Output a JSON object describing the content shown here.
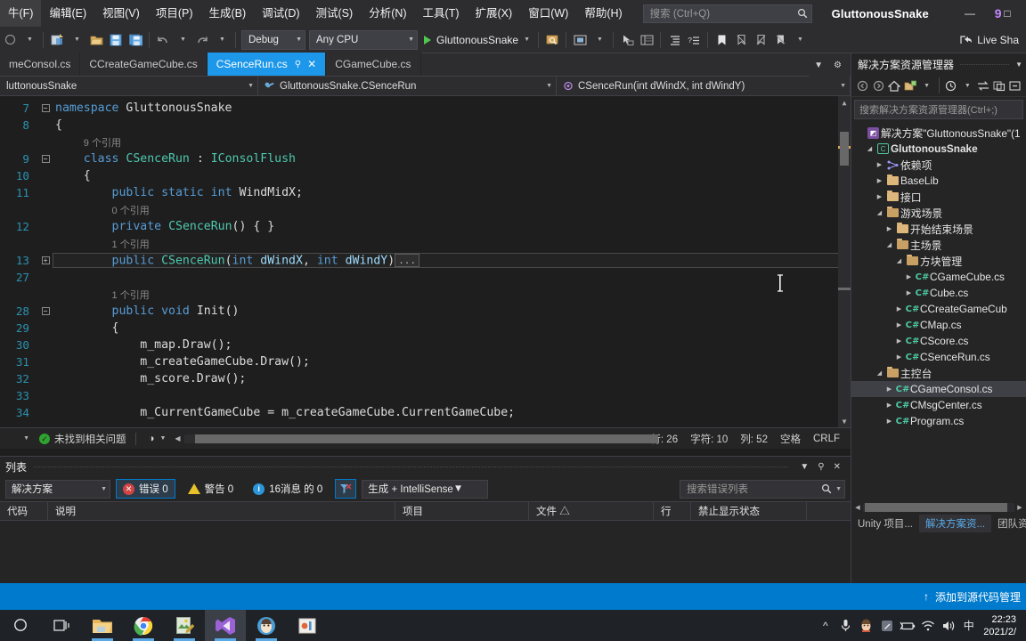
{
  "titlebar": {
    "menu": [
      "牛(F)",
      "编辑(E)",
      "视图(V)",
      "项目(P)",
      "生成(B)",
      "调试(D)",
      "测试(S)",
      "分析(N)",
      "工具(T)",
      "扩展(X)",
      "窗口(W)",
      "帮助(H)"
    ],
    "search_placeholder": "搜索 (Ctrl+Q)",
    "solution_name": "GluttonousSnake",
    "notification_count": "9",
    "minimize": "—",
    "restore": "□"
  },
  "toolbar": {
    "config": "Debug",
    "platform": "Any CPU",
    "run_target": "GluttonousSnake",
    "live_share": "Live Sha"
  },
  "tabs": [
    {
      "label": "meConsol.cs",
      "active": false
    },
    {
      "label": "CCreateGameCube.cs",
      "active": false
    },
    {
      "label": "CSenceRun.cs",
      "active": true
    },
    {
      "label": "CGameCube.cs",
      "active": false
    }
  ],
  "navbar": {
    "project": "luttonousSnake",
    "type": "GluttonousSnake.CSenceRun",
    "member": "CSenceRun(int dWindX, int dWindY)"
  },
  "code": {
    "lines": [
      {
        "num": "7",
        "fold": "minus",
        "segments": [
          {
            "t": "namespace ",
            "c": "kw"
          },
          {
            "t": "GluttonousSnake",
            "c": "pln"
          }
        ],
        "indent": ""
      },
      {
        "num": "8",
        "fold": "",
        "segments": [
          {
            "t": "{",
            "c": "pln"
          }
        ],
        "indent": ""
      },
      {
        "num": "",
        "fold": "",
        "ref": "9 个引用",
        "indent": "    "
      },
      {
        "num": "9",
        "fold": "minus",
        "segments": [
          {
            "t": "class ",
            "c": "kw"
          },
          {
            "t": "CSenceRun",
            "c": "typ"
          },
          {
            "t": " : ",
            "c": "pln"
          },
          {
            "t": "IConsolFlush",
            "c": "typ"
          }
        ],
        "indent": "    "
      },
      {
        "num": "10",
        "fold": "",
        "segments": [
          {
            "t": "{",
            "c": "pln"
          }
        ],
        "indent": "    "
      },
      {
        "num": "11",
        "fold": "",
        "segments": [
          {
            "t": "public static int ",
            "c": "kw"
          },
          {
            "t": "WindMidX;",
            "c": "pln"
          }
        ],
        "indent": "        "
      },
      {
        "num": "",
        "fold": "",
        "ref": "0 个引用",
        "indent": "        "
      },
      {
        "num": "12",
        "fold": "",
        "segments": [
          {
            "t": "private ",
            "c": "kw"
          },
          {
            "t": "CSenceRun",
            "c": "typ"
          },
          {
            "t": "() { }",
            "c": "pln"
          }
        ],
        "indent": "        "
      },
      {
        "num": "",
        "fold": "",
        "ref": "1 个引用",
        "indent": "        "
      },
      {
        "num": "13",
        "fold": "plus",
        "current": true,
        "segments": [
          {
            "t": "public ",
            "c": "kw"
          },
          {
            "t": "CSenceRun",
            "c": "typ"
          },
          {
            "t": "(",
            "c": "pln"
          },
          {
            "t": "int ",
            "c": "kw"
          },
          {
            "t": "dWindX",
            "c": "par"
          },
          {
            "t": ", ",
            "c": "pln"
          },
          {
            "t": "int ",
            "c": "kw"
          },
          {
            "t": "dWindY",
            "c": "par"
          },
          {
            "t": ")",
            "c": "pln"
          }
        ],
        "ellipsis": "...",
        "indent": "        "
      },
      {
        "num": "27",
        "fold": "",
        "segments": [],
        "indent": ""
      },
      {
        "num": "",
        "fold": "",
        "ref": "1 个引用",
        "indent": "        "
      },
      {
        "num": "28",
        "fold": "minus",
        "segments": [
          {
            "t": "public void ",
            "c": "kw"
          },
          {
            "t": "Init",
            "c": "pln"
          },
          {
            "t": "()",
            "c": "pln"
          }
        ],
        "indent": "        "
      },
      {
        "num": "29",
        "fold": "",
        "segments": [
          {
            "t": "{",
            "c": "pln"
          }
        ],
        "indent": "        "
      },
      {
        "num": "30",
        "fold": "",
        "segments": [
          {
            "t": "m_map.Draw();",
            "c": "pln"
          }
        ],
        "indent": "            "
      },
      {
        "num": "31",
        "fold": "",
        "segments": [
          {
            "t": "m_createGameCube.Draw();",
            "c": "pln"
          }
        ],
        "indent": "            "
      },
      {
        "num": "32",
        "fold": "",
        "segments": [
          {
            "t": "m_score.Draw();",
            "c": "pln"
          }
        ],
        "indent": "            "
      },
      {
        "num": "33",
        "fold": "",
        "segments": [],
        "indent": ""
      },
      {
        "num": "34",
        "fold": "",
        "segments": [
          {
            "t": "m_CurrentGameCube = m_createGameCube.CurrentGameCube;",
            "c": "pln"
          }
        ],
        "indent": "            "
      }
    ]
  },
  "editor_status": {
    "issues": "未找到相关问题",
    "line": "行: 26",
    "char": "字符: 10",
    "col": "列: 52",
    "spaces": "空格",
    "eol": "CRLF"
  },
  "error_panel": {
    "title": "列表",
    "scope": "解决方案",
    "errors": "错误 0",
    "warnings": "警告 0",
    "messages": "16消息 的 0",
    "build_filter": "生成 + IntelliSense",
    "search_placeholder": "搜索错误列表",
    "columns": [
      "代码",
      "说明",
      "项目",
      "文件 △",
      "行",
      "禁止显示状态"
    ],
    "rows": []
  },
  "solution_explorer": {
    "title": "解决方案资源管理器",
    "search_placeholder": "搜索解决方案资源管理器(Ctrl+;)",
    "tree": [
      {
        "label": "解决方案\"GluttonousSnake\"(1 ",
        "depth": 0,
        "icon": "solution",
        "arrow": "",
        "bold": false
      },
      {
        "label": "GluttonousSnake",
        "depth": 1,
        "icon": "project",
        "arrow": "down",
        "bold": true
      },
      {
        "label": "依赖项",
        "depth": 2,
        "icon": "dependency",
        "arrow": "right",
        "bold": false
      },
      {
        "label": "BaseLib",
        "depth": 2,
        "icon": "folder",
        "arrow": "right",
        "bold": false
      },
      {
        "label": "接口",
        "depth": 2,
        "icon": "folder",
        "arrow": "right",
        "bold": false
      },
      {
        "label": "游戏场景",
        "depth": 2,
        "icon": "folder-open",
        "arrow": "down",
        "bold": false
      },
      {
        "label": "开始结束场景",
        "depth": 3,
        "icon": "folder",
        "arrow": "right",
        "bold": false
      },
      {
        "label": "主场景",
        "depth": 3,
        "icon": "folder-open",
        "arrow": "down",
        "bold": false
      },
      {
        "label": "方块管理",
        "depth": 4,
        "icon": "folder-open",
        "arrow": "down",
        "bold": false
      },
      {
        "label": "CGameCube.cs",
        "depth": 5,
        "icon": "cs",
        "arrow": "right",
        "bold": false
      },
      {
        "label": "Cube.cs",
        "depth": 5,
        "icon": "cs",
        "arrow": "right",
        "bold": false
      },
      {
        "label": "CCreateGameCub",
        "depth": 4,
        "icon": "cs",
        "arrow": "right",
        "bold": false
      },
      {
        "label": "CMap.cs",
        "depth": 4,
        "icon": "cs",
        "arrow": "right",
        "bold": false
      },
      {
        "label": "CScore.cs",
        "depth": 4,
        "icon": "cs",
        "arrow": "right",
        "bold": false
      },
      {
        "label": "CSenceRun.cs",
        "depth": 4,
        "icon": "cs",
        "arrow": "right",
        "bold": false
      },
      {
        "label": "主控台",
        "depth": 2,
        "icon": "folder-open",
        "arrow": "down",
        "bold": false
      },
      {
        "label": "CGameConsol.cs",
        "depth": 3,
        "icon": "cs",
        "arrow": "right",
        "bold": false,
        "selected": true
      },
      {
        "label": "CMsgCenter.cs",
        "depth": 3,
        "icon": "cs",
        "arrow": "right",
        "bold": false
      },
      {
        "label": "Program.cs",
        "depth": 3,
        "icon": "cs",
        "arrow": "right",
        "bold": false
      }
    ],
    "tabs": [
      {
        "label": "Unity 项目...",
        "active": false
      },
      {
        "label": "解决方案资...",
        "active": true
      },
      {
        "label": "团队资...",
        "active": false
      }
    ]
  },
  "status_bar": {
    "source_control": "添加到源代码管理",
    "arrow": "↑"
  },
  "taskbar": {
    "apps": [
      "search-icon",
      "task-view-icon",
      "file-explorer-icon",
      "chrome-icon",
      "notepad-icon",
      "visual-studio-icon",
      "qq-icon",
      "media-icon"
    ],
    "ime": "中",
    "time": "22:23",
    "date": "2021/2/"
  },
  "colors": {
    "accent": "#007acc",
    "tab_active": "#1c97ea",
    "editor_bg": "#1e1e1e",
    "chrome_bg": "#2d2d30",
    "panel_bg": "#252526",
    "keyword": "#569cd6",
    "type": "#4ec9b0",
    "param": "#9cdcfe",
    "linenum": "#2b91af",
    "error_red": "#d14545",
    "warn_yellow": "#e8c12a",
    "info_blue": "#2b96d9",
    "badge_purple": "#c586ff"
  }
}
